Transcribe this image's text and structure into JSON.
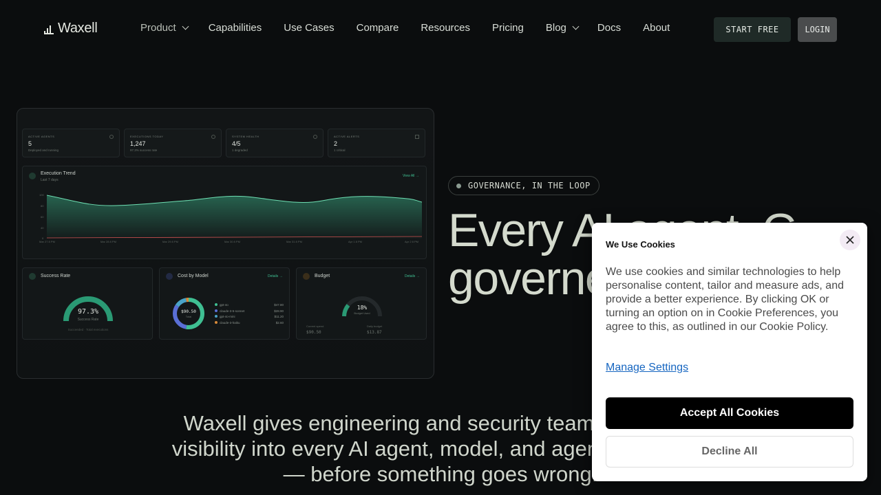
{
  "nav": {
    "brand": "Waxell",
    "items": [
      {
        "label": "Product",
        "dropdown": true
      },
      {
        "label": "Capabilities",
        "dropdown": false
      },
      {
        "label": "Use Cases",
        "dropdown": false
      },
      {
        "label": "Compare",
        "dropdown": false
      },
      {
        "label": "Resources",
        "dropdown": false
      },
      {
        "label": "Pricing",
        "dropdown": false
      },
      {
        "label": "Blog",
        "dropdown": true
      },
      {
        "label": "Docs",
        "dropdown": false
      },
      {
        "label": "About",
        "dropdown": false
      }
    ],
    "start_label": "START FREE",
    "login_label": "LOGIN"
  },
  "dashboard": {
    "stats": [
      {
        "label": "Active Agents",
        "value": "5",
        "sub": "Deployed and running"
      },
      {
        "label": "Executions Today",
        "value": "1,247",
        "sub": "97.3% success rate"
      },
      {
        "label": "System Health",
        "value": "4/5",
        "sub": "1 degraded"
      },
      {
        "label": "Active Alerts",
        "value": "2",
        "sub": "1 critical"
      }
    ],
    "trend": {
      "title": "Execution Trend",
      "subtitle": "Last 7 days",
      "link": "View All →",
      "y_ticks": [
        "100",
        "80",
        "60",
        "40",
        "0"
      ],
      "x_ticks": [
        "Mar 27 8 PM",
        "Mar 28 8 PM",
        "Mar 29 8 PM",
        "Mar 30 8 PM",
        "Mar 31 8 PM",
        "Apr 1 8 PM",
        "Apr 2 8 PM"
      ]
    },
    "success": {
      "title": "Success Rate",
      "value": "97.3%",
      "label": "Success Rate",
      "footer": "Succeeded · Total executions"
    },
    "cost": {
      "title": "Cost by Model",
      "link": "Details →",
      "total": "$90.50",
      "total_label": "Total",
      "legend": [
        {
          "name": "gpt-4o",
          "value": "$47.80",
          "color": "#3fbf92"
        },
        {
          "name": "claude-3-5-sonnet",
          "value": "$28.90",
          "color": "#5a6fd6"
        },
        {
          "name": "gpt-4o-mini",
          "value": "$11.20",
          "color": "#4aa3c7"
        },
        {
          "name": "claude-3-haiku",
          "value": "$2.60",
          "color": "#d68a3a"
        }
      ]
    },
    "budget": {
      "title": "Budget",
      "link": "Details →",
      "percent": "18%",
      "percent_label": "Budget Used",
      "spent_label": "Current spend",
      "spent": "$90.50",
      "remaining_label": "Daily budget",
      "remaining": "$13.87"
    }
  },
  "hero": {
    "badge": "GOVERNANCE, IN THE LOOP",
    "title_line1": "Every AI agent. G",
    "title_line2": "governed.",
    "description": "Waxell gives engineering and security teams complete visibility into every AI agent, model, and agentic workflow — before something goes wrong."
  },
  "cookie": {
    "title": "We Use Cookies",
    "body": "We use cookies and similar technologies to help personalise content, tailor and measure ads, and provide a better experience. By clicking OK or turning an option on in Cookie Preferences, you agree to this, as outlined in our Cookie Policy.",
    "manage": "Manage Settings",
    "accept": "Accept All Cookies",
    "decline": "Decline All"
  },
  "colors": {
    "accent": "#3fbf92",
    "bg": "#0b0d0e",
    "start_button": "#1f2a27",
    "login_button": "#4a4c4d"
  }
}
